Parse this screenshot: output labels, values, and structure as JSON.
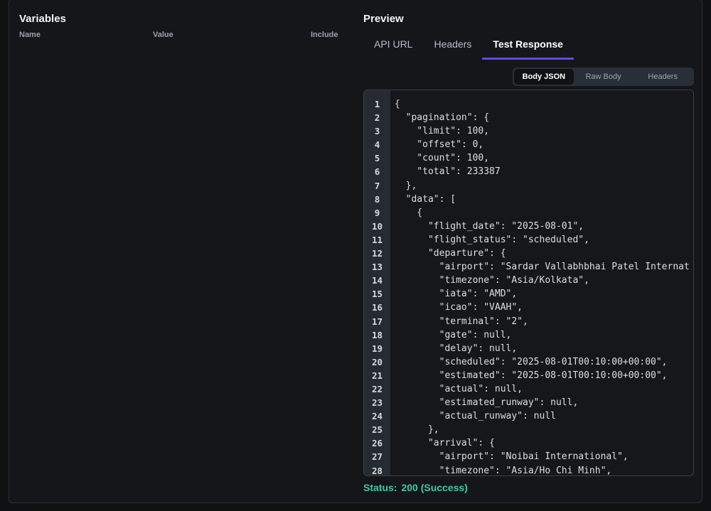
{
  "variables": {
    "title": "Variables",
    "columns": {
      "name": "Name",
      "value": "Value",
      "include": "Include"
    }
  },
  "preview": {
    "title": "Preview",
    "tabs": [
      {
        "label": "API URL",
        "active": false
      },
      {
        "label": "Headers",
        "active": false
      },
      {
        "label": "Test Response",
        "active": true
      }
    ],
    "response_views": [
      {
        "label": "Body JSON",
        "active": true
      },
      {
        "label": "Raw Body",
        "active": false
      },
      {
        "label": "Headers",
        "active": false
      }
    ],
    "code_lines": [
      "{",
      "  \"pagination\": {",
      "    \"limit\": 100,",
      "    \"offset\": 0,",
      "    \"count\": 100,",
      "    \"total\": 233387",
      "  },",
      "  \"data\": [",
      "    {",
      "      \"flight_date\": \"2025-08-01\",",
      "      \"flight_status\": \"scheduled\",",
      "      \"departure\": {",
      "        \"airport\": \"Sardar Vallabhbhai Patel Internat",
      "        \"timezone\": \"Asia/Kolkata\",",
      "        \"iata\": \"AMD\",",
      "        \"icao\": \"VAAH\",",
      "        \"terminal\": \"2\",",
      "        \"gate\": null,",
      "        \"delay\": null,",
      "        \"scheduled\": \"2025-08-01T00:10:00+00:00\",",
      "        \"estimated\": \"2025-08-01T00:10:00+00:00\",",
      "        \"actual\": null,",
      "        \"estimated_runway\": null,",
      "        \"actual_runway\": null",
      "      },",
      "      \"arrival\": {",
      "        \"airport\": \"Noibai International\",",
      "        \"timezone\": \"Asia/Ho Chi Minh\","
    ],
    "status": {
      "label": "Status:",
      "value": "200 (Success)"
    }
  },
  "colors": {
    "accent": "#5b4fe0",
    "success": "#3fc8a8",
    "background": "#101113"
  }
}
